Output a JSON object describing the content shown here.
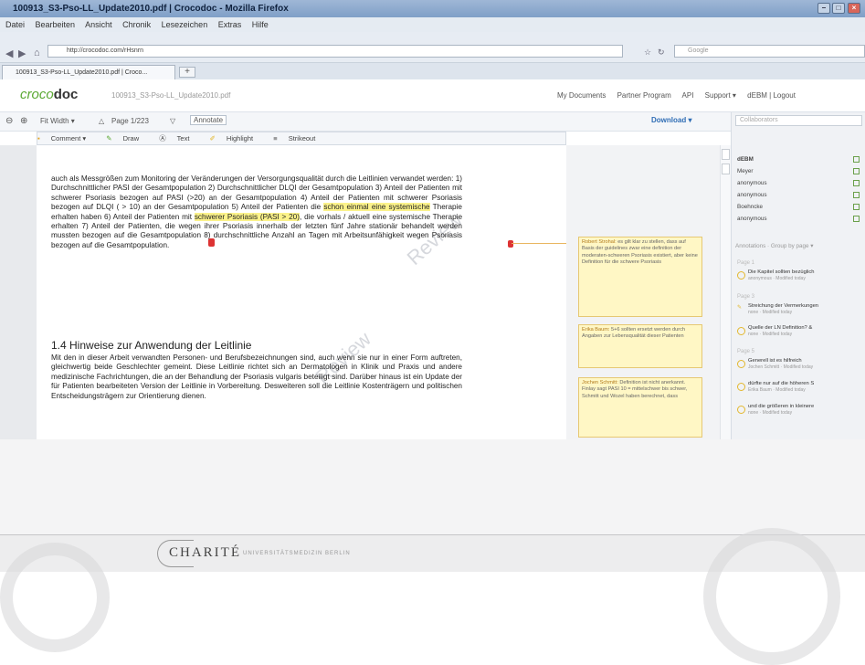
{
  "window": {
    "title": "100913_S3-Pso-LL_Update2010.pdf | Crocodoc - Mozilla Firefox"
  },
  "menu": [
    "Datei",
    "Bearbeiten",
    "Ansicht",
    "Chronik",
    "Lesezeichen",
    "Extras",
    "Hilfe"
  ],
  "browser": {
    "url": "http://crocodoc.com/rHsnrn",
    "search_placeholder": "Google",
    "tab_label": "100913_S3-Pso-LL_Update2010.pdf | Croco...",
    "new_tab": "+"
  },
  "app": {
    "logo_brand": "crocodoc",
    "logo_prefix": "croco",
    "logo_suffix": "doc",
    "doc_title": "100913_S3-Pso-LL_Update2010.pdf",
    "nav": [
      "My Documents",
      "Partner Program",
      "API",
      "Support ▾",
      "dEBM | Logout"
    ]
  },
  "toolbar": {
    "fit": "Fit Width ▾",
    "page": "Page 1/223",
    "annotate": "Annotate",
    "download": "Download ▾"
  },
  "annotation_tools": [
    "Comment ▾",
    "Draw",
    "Text",
    "Highlight",
    "Strikeout"
  ],
  "document": {
    "para1_a": "auch als Messgrößen zum Monitoring der Veränderungen der Versorgungsqualität durch die Leitlinien verwandet werden: 1) Durchschnittlicher PASI der Gesamtpopulation 2) Durchschnittlicher DLQI der Gesamtpopulation 3) Anteil der Patienten mit schwerer Psoriasis bezogen auf PASI (>20) an der Gesamtpopulation 4) Anteil der Patienten mit schwerer Psoriasis bezogen auf DLQI ( > 10) an der Gesamtpopulation 5) Anteil der Patienten die ",
    "para1_hl1": "schon einmal eine systemische",
    "para1_b": " Therapie erhalten haben 6) Anteil der Patienten mit ",
    "para1_hl2": "schwerer Psoriasis (PASI > 20)",
    "para1_c": ", die vorhals / aktuell eine systemische Therapie erhalten 7) Anteil der Patienten, die wegen ihrer Psoriasis innerhalb der letzten fünf Jahre stationär behandelt werden mussten bezogen auf die Gesamtpopulation 8) durchschnittliche Anzahl an Tagen mit Arbeitsunfähigkeit wegen Psoriasis bezogen auf die Gesamtpopulation.",
    "section_title": "1.4   Hinweise zur Anwendung der Leitlinie",
    "para2": "Mit den in dieser Arbeit verwandten Personen- und Berufsbezeichnungen sind, auch wenn sie nur in einer Form auftreten, gleichwertig beide Geschlechter gemeint. Diese Leitlinie richtet sich an Dermatologen in Klinik und Praxis und andere medizinische Fachrichtungen, die an der Behandlung der Psoriasis vulgaris beteiligt sind. Darüber hinaus ist ein Update der für Patienten bearbeiteten Version der Leitlinie in Vorbereitung. Desweiteren soll die Leitlinie Kostenträgern und politischen Entscheidungsträgern zur Orientierung dienen.",
    "watermark": "Review"
  },
  "comments": [
    {
      "author": "Robert Strohal:",
      "text": "es gilt klar zu stellen, dass auf Basis der guidelines zwar eine definition der moderaten-schweren Psoriasis existiert, aber keine Definition für die schwere Psoriasis"
    },
    {
      "author": "Erika Baum:",
      "text": "5+6 sollten ersetzt werden durch Angaben zur Lebensqualität dieser Patienten"
    },
    {
      "author": "Jochen Schmitt:",
      "text": "Definition ist nicht anerkannt. Finlay sagt PASI 10 = mittelschwer bis schwer, Schmitt und Wozel haben berechnet, dass"
    }
  ],
  "sidebar": {
    "collab_header": "Collaborators",
    "users": [
      "dEBM",
      "Meyer",
      "anonymous",
      "anonymous",
      "Boehncke",
      "anonymous"
    ],
    "ann_header": "Annotations · Group by page ▾",
    "annotations": [
      {
        "page": "Page 1",
        "title": "Die Kapitel sollten bezüglich",
        "meta": "anonymous · Modified today"
      },
      {
        "page": "Page 3",
        "title": "Streichung der Vermerkungen",
        "meta": "none · Modified today"
      },
      {
        "page": "",
        "title": "Quelle der LN Definition? &",
        "meta": "none · Modified today"
      },
      {
        "page": "Page 5",
        "title": "Generell ist es hilfreich",
        "meta": "Jochen Schmitt · Modified today"
      },
      {
        "page": "",
        "title": "dürfte nur auf die höheren S",
        "meta": "Erika Baum · Modified today"
      },
      {
        "page": "",
        "title": "und die größeren in kleinere",
        "meta": "none · Modified today"
      }
    ]
  },
  "footer": {
    "logo": "CHARITÉ",
    "sub": "UNIVERSITÄTSMEDIZIN BERLIN"
  }
}
